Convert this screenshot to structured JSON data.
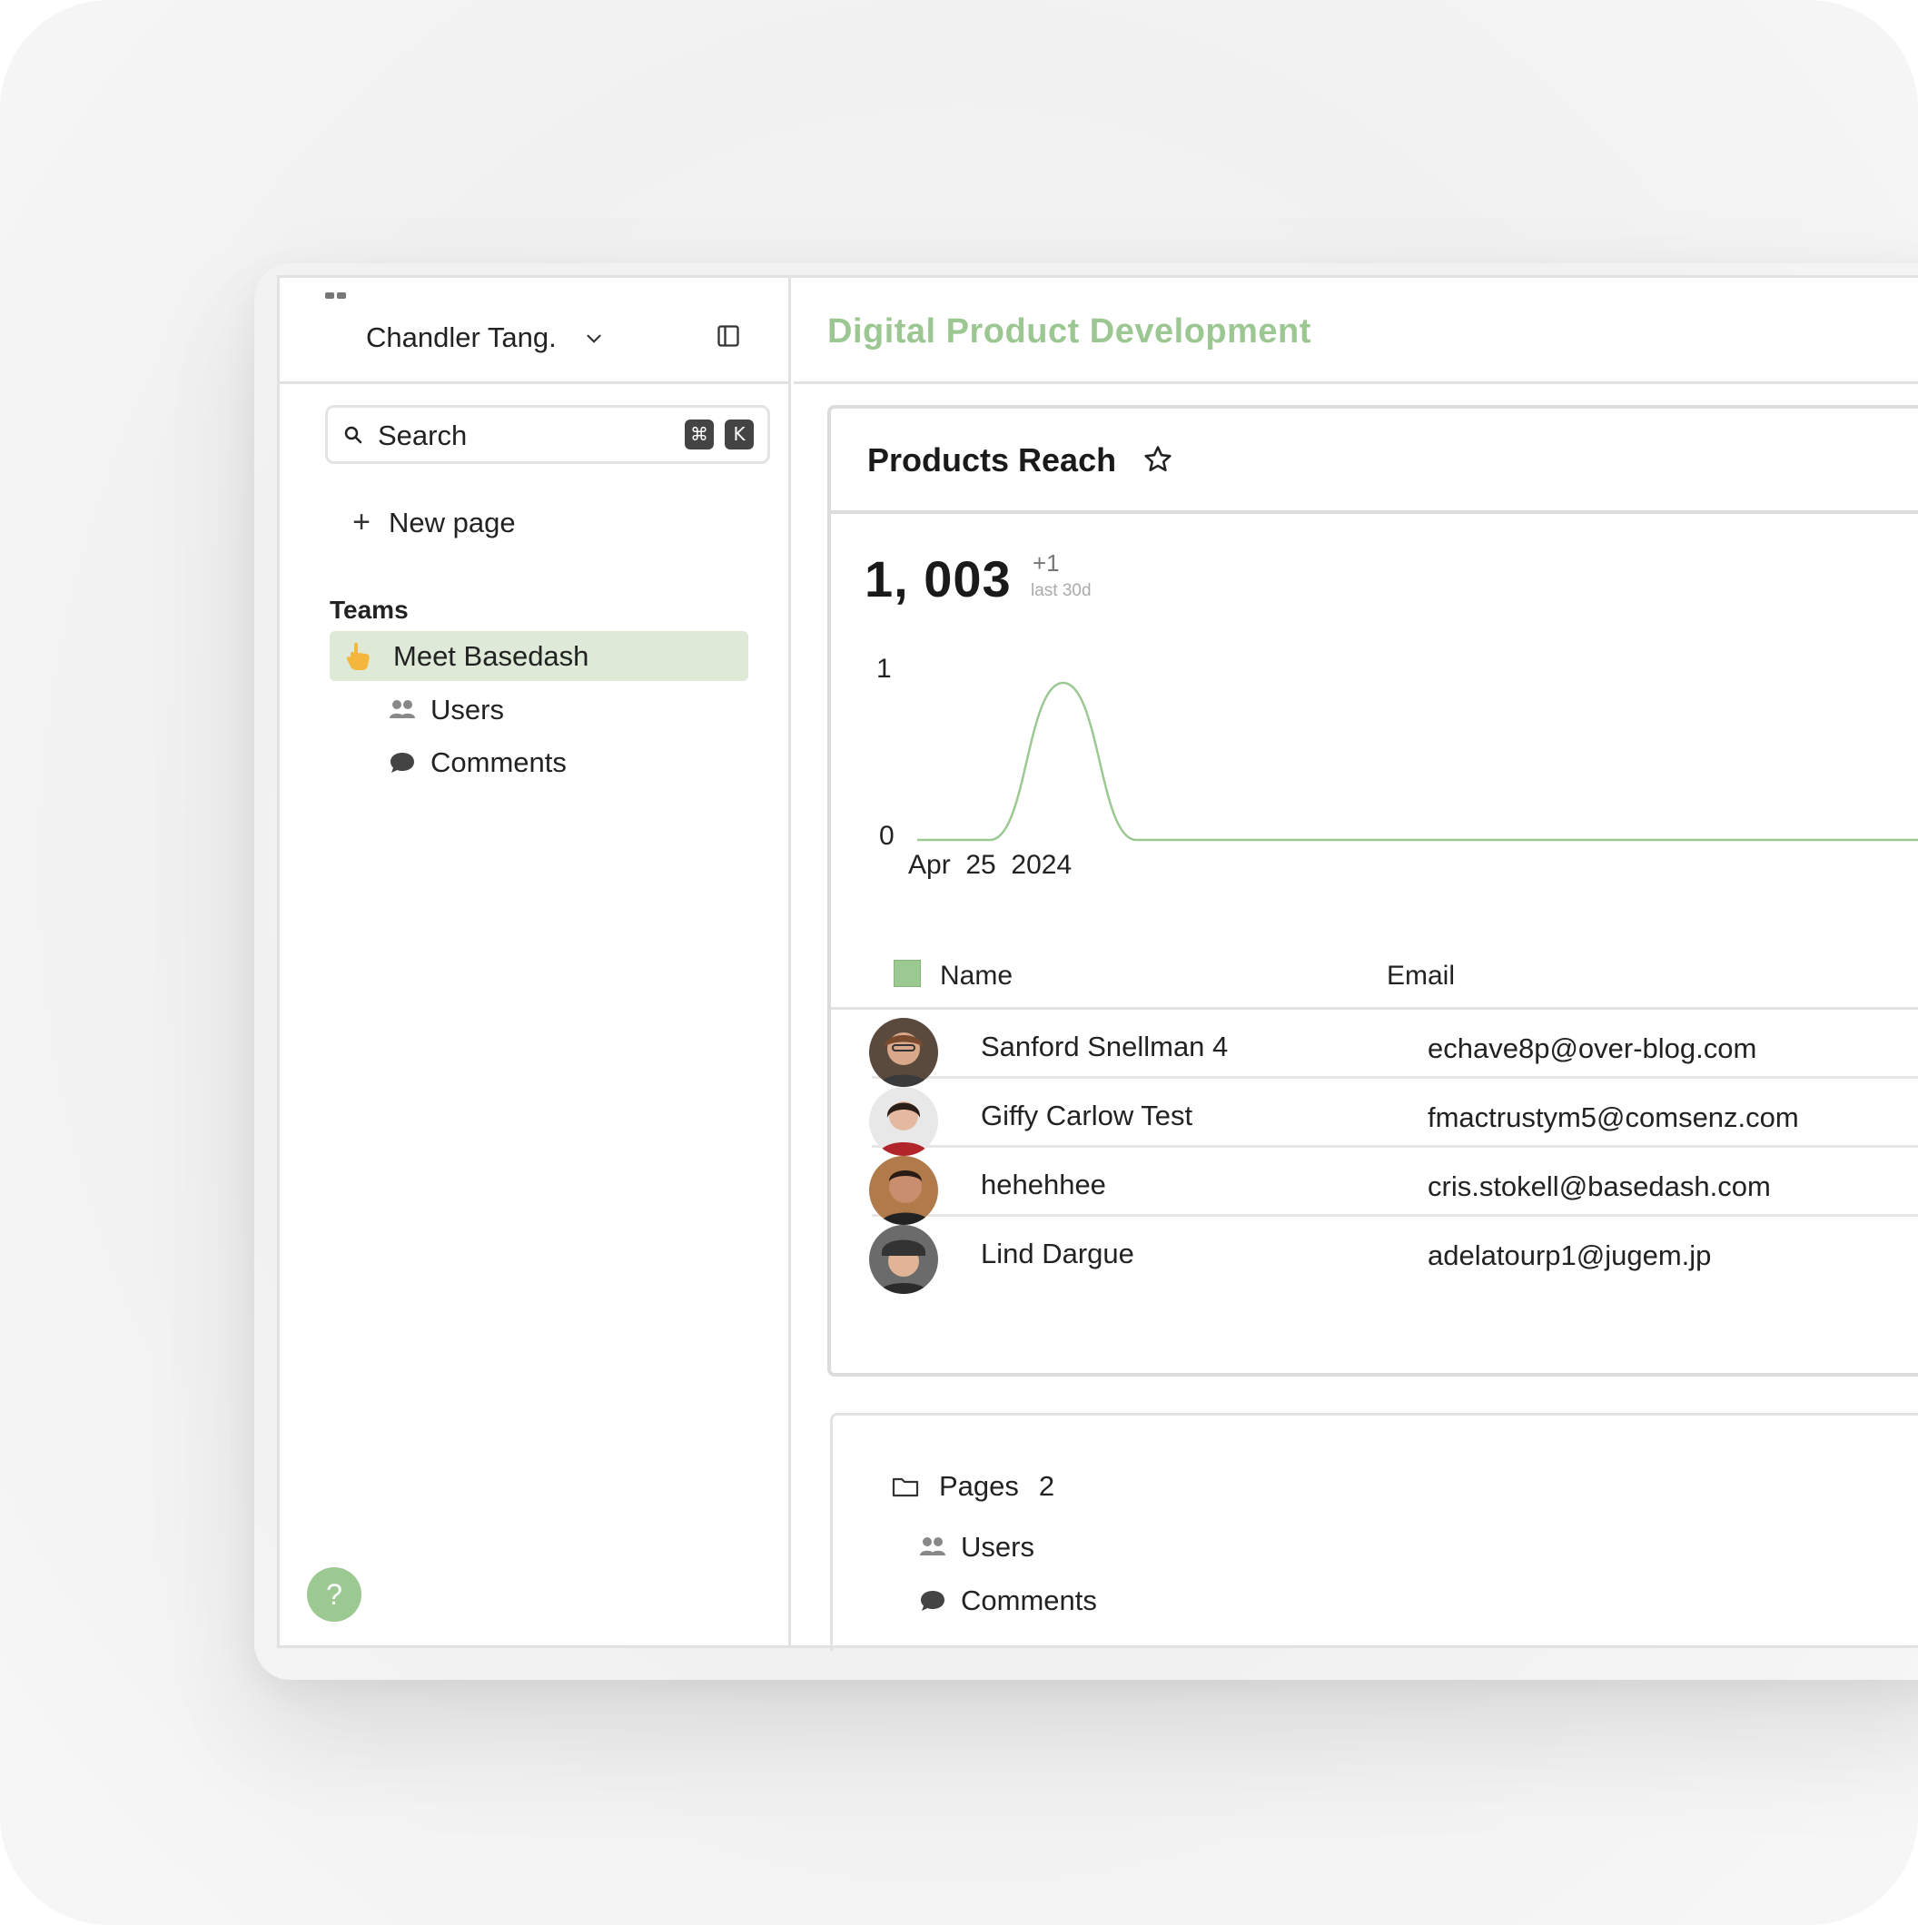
{
  "workspace": {
    "name": "Chandler Tang."
  },
  "search": {
    "label": "Search",
    "shortcut_cmd": "⌘",
    "shortcut_key": "K"
  },
  "sidebar": {
    "new_page_label": "New page",
    "section_label": "Teams",
    "team": {
      "label": "Meet Basedash",
      "icon": "pointing-hand-icon"
    },
    "items": [
      {
        "label": "Users",
        "icon": "users-icon"
      },
      {
        "label": "Comments",
        "icon": "comment-icon"
      }
    ],
    "help_label": "?"
  },
  "page": {
    "title": "Digital Product Development"
  },
  "card": {
    "title": "Products Reach",
    "stat_value": "1, 003",
    "stat_delta": "+1",
    "stat_period": "last 30d"
  },
  "chart_data": {
    "type": "line",
    "x": [
      "Apr 25 2024",
      "",
      "",
      "",
      "",
      "",
      "",
      "",
      "",
      "",
      "",
      "",
      "",
      "",
      "",
      ""
    ],
    "series": [
      {
        "values": [
          0,
          0,
          1,
          0,
          0,
          0,
          0,
          0,
          0,
          0,
          0,
          0,
          0,
          0,
          0,
          0
        ]
      }
    ],
    "ylim": [
      0,
      1
    ],
    "y_ticks": [
      "1",
      "0"
    ],
    "x_tick_label": "Apr  25  2024",
    "color": "#9cc892",
    "grid": false
  },
  "table": {
    "columns": [
      "Name",
      "Email"
    ],
    "rows": [
      {
        "name": "Sanford Snellman 4",
        "email": "echave8p@over-blog.com"
      },
      {
        "name": "Giffy Carlow Test",
        "email": "fmactrustym5@comsenz.com"
      },
      {
        "name": "hehehhee",
        "email": "cris.stokell@basedash.com"
      },
      {
        "name": "Lind Dargue",
        "email": "adelatourp1@jugem.jp"
      }
    ]
  },
  "pages_section": {
    "label": "Pages",
    "count": "2",
    "items": [
      {
        "label": "Users",
        "icon": "users-icon"
      },
      {
        "label": "Comments",
        "icon": "comment-icon"
      }
    ]
  },
  "colors": {
    "accent": "#9cc892",
    "selected_bg": "#deead7"
  }
}
